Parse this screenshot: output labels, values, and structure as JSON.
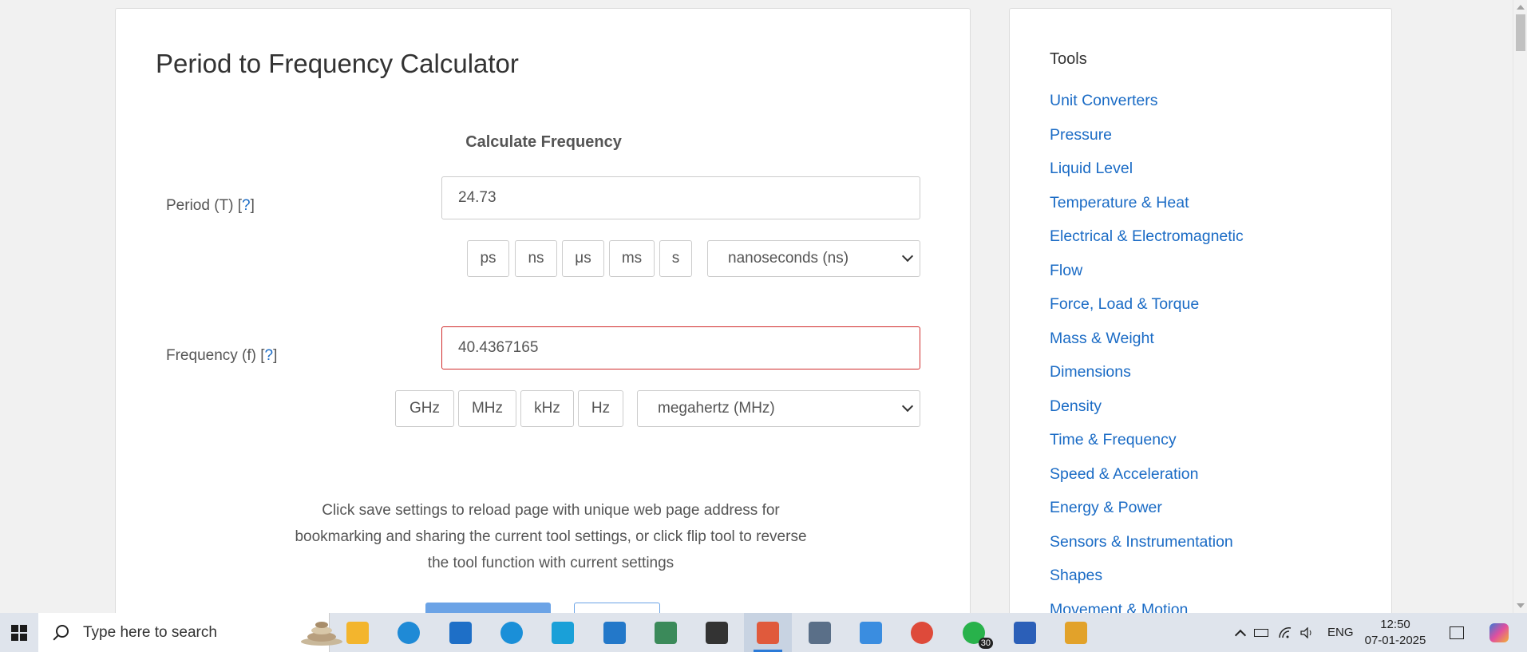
{
  "page": {
    "title": "Period to Frequency Calculator",
    "section_heading": "Calculate Frequency"
  },
  "period": {
    "label": "Period (T) [",
    "help": "?",
    "label_end": "]",
    "value": "24.73",
    "units": [
      "ps",
      "ns",
      "μs",
      "ms",
      "s"
    ],
    "selected_unit": "nanoseconds (ns)"
  },
  "frequency": {
    "label": "Frequency (f) [",
    "help": "?",
    "label_end": "]",
    "value": "40.4367165",
    "units": [
      "GHz",
      "MHz",
      "kHz",
      "Hz"
    ],
    "selected_unit": "megahertz (MHz)"
  },
  "info_text": "Click save settings to reload page with unique web page address for bookmarking and sharing the current tool settings, or click flip tool to reverse the tool function with current settings",
  "sidebar": {
    "title": "Tools",
    "links": [
      "Unit Converters",
      "Pressure",
      "Liquid Level",
      "Temperature & Heat",
      "Electrical & Electromagnetic",
      "Flow",
      "Force, Load & Torque",
      "Mass & Weight",
      "Dimensions",
      "Density",
      "Time & Frequency",
      "Speed & Acceleration",
      "Energy & Power",
      "Sensors & Instrumentation",
      "Shapes",
      "Movement & Motion"
    ]
  },
  "taskbar": {
    "search_placeholder": "Type here to search",
    "language": "ENG",
    "time": "12:50",
    "date": "07-01-2025",
    "whatsapp_badge": "30",
    "apps": [
      {
        "name": "file-explorer-icon",
        "color": "#f3b52d"
      },
      {
        "name": "edge-icon",
        "color": "#1f8ad6"
      },
      {
        "name": "mail-icon",
        "color": "#1e6fc7"
      },
      {
        "name": "cortana-icon",
        "color": "#1a8fd8"
      },
      {
        "name": "prime-video-icon",
        "color": "#1aa0d8"
      },
      {
        "name": "vscode-icon",
        "color": "#2378c9"
      },
      {
        "name": "visual-studio-icon",
        "color": "#3b8a5a"
      },
      {
        "name": "settings-icon",
        "color": "#333333"
      },
      {
        "name": "snipping-tool-icon",
        "color": "#e05a3c"
      },
      {
        "name": "calculator-icon",
        "color": "#5a6f88"
      },
      {
        "name": "photos-icon",
        "color": "#3a8de0"
      },
      {
        "name": "chrome-icon",
        "color": "#de4a3a"
      },
      {
        "name": "whatsapp-icon",
        "color": "#28b24b"
      },
      {
        "name": "word-icon",
        "color": "#2b5fb8"
      },
      {
        "name": "paint-icon",
        "color": "#e2a22a"
      }
    ]
  }
}
